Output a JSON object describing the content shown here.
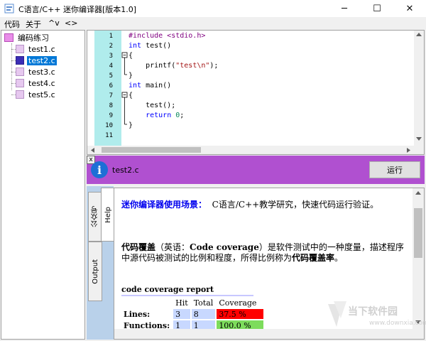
{
  "window": {
    "title": "C语言/C++ 迷你编译器[版本1.0]",
    "minimize": "─",
    "maximize": "☐",
    "close": "✕"
  },
  "menu": [
    "代码",
    "关于",
    "^v",
    "<>"
  ],
  "tree": {
    "root": "编码练习",
    "files": [
      "test1.c",
      "test2.c",
      "test3.c",
      "test4.c",
      "test5.c"
    ],
    "selected": "test2.c"
  },
  "editor": {
    "lines": [
      "1",
      "2",
      "3",
      "4",
      "5",
      "6",
      "7",
      "8",
      "9",
      "10",
      "11"
    ],
    "code": {
      "l1_pp": "#include <stdio.h>",
      "l2_kw": "int",
      "l2_rest": " test()",
      "l3": "{",
      "l4_pre": "    printf(",
      "l4_str": "\"test\\n\"",
      "l4_post": ");",
      "l5": "}",
      "l6_kw": "int",
      "l6_rest": " main()",
      "l7": "{",
      "l8": "    test();",
      "l9_pre": "    ",
      "l9_kw": "return",
      "l9_sp": " ",
      "l9_num": "0",
      "l9_post": ";",
      "l10": "}"
    }
  },
  "status": {
    "close_glyph": "x",
    "info_glyph": "i",
    "file": "test2.c",
    "run_label": "运行"
  },
  "side_tabs": [
    "公众号",
    "Help",
    "Output"
  ],
  "help": {
    "scene_title": "迷你编译器使用场景：",
    "scene_text": "C语言/C++教学研究，快速代码运行验证。",
    "cov_term": "代码覆盖",
    "cov_paren_pre": "（英语：",
    "cov_en": "Code coverage",
    "cov_paren_post": "）是软件测试中的一种度量，描述程序",
    "cov_line2_pre": "中源代码被测试的比例和程度，所得比例称为",
    "cov_rate": "代码覆盖率",
    "cov_line2_post": "。",
    "report_title": "code coverage report",
    "headers": [
      "Hit",
      "Total",
      "Coverage"
    ],
    "rows": [
      {
        "label": "Lines:",
        "hit": "3",
        "total": "8",
        "coverage": "37.5 %"
      },
      {
        "label": "Functions:",
        "hit": "1",
        "total": "1",
        "coverage": "100.0 %"
      }
    ]
  },
  "watermark": {
    "text": "当下软件园",
    "url": "www.downxia.com"
  },
  "colors": {
    "status_bar": "#b050d0",
    "gutter": "#b0ecec",
    "selected": "#0078d7",
    "cov_low": "#ff0000",
    "cov_high": "#7ddc5c"
  }
}
